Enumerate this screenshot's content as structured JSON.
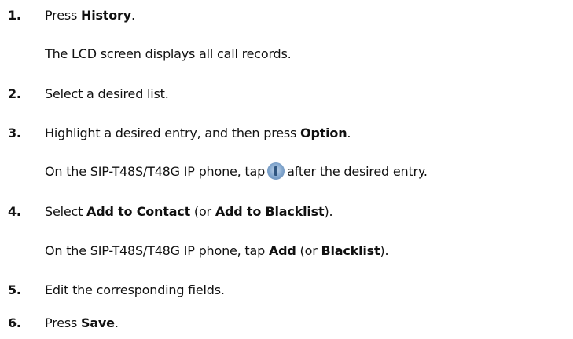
{
  "steps": [
    {
      "num": "1.",
      "pre": "Press ",
      "bold": "History",
      "post": ".",
      "note": "The LCD screen displays all call records."
    },
    {
      "num": "2.",
      "text": "Select a desired list."
    },
    {
      "num": "3.",
      "pre": "Highlight a desired entry, and then press ",
      "bold": "Option",
      "post": ".",
      "note_pre": "On the SIP-T48S/T48G IP phone, tap",
      "note_icon": "info-icon",
      "note_post": "after the desired entry."
    },
    {
      "num": "4.",
      "pre": "Select ",
      "bold1": "Add to Contact",
      "mid": " (or ",
      "bold2": "Add to Blacklist",
      "post": ").",
      "note_pre": "On the SIP-T48S/T48G IP phone, tap ",
      "note_bold1": "Add",
      "note_mid": " (or ",
      "note_bold2": "Blacklist",
      "note_post": ")."
    },
    {
      "num": "5.",
      "text": "Edit the corresponding fields."
    },
    {
      "num": "6.",
      "pre": "Press ",
      "bold": "Save",
      "post": "."
    }
  ]
}
